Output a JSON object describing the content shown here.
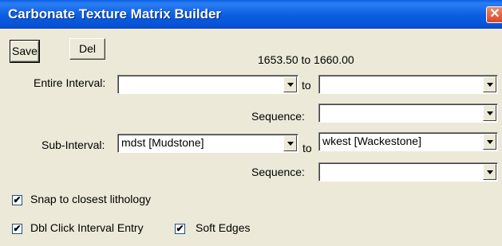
{
  "window": {
    "title": "Carbonate Texture Matrix Builder",
    "close_glyph": "✕"
  },
  "toolbar": {
    "save_label": "Save",
    "delete_label": "Del"
  },
  "depth_range": "1653.50 to 1660.00",
  "entire_interval": {
    "label": "Entire Interval:",
    "from_value": "",
    "to_label": "to",
    "to_value": "",
    "sequence_label": "Sequence:",
    "sequence_value": ""
  },
  "sub_interval": {
    "label": "Sub-Interval:",
    "from_value": "mdst  [Mudstone]",
    "to_label": "to",
    "to_value": "wkest  [Wackestone]",
    "sequence_label": "Sequence:",
    "sequence_value": ""
  },
  "options": {
    "snap": {
      "label": "Snap to closest lithology",
      "checked": true
    },
    "dbl_click": {
      "label": "Dbl Click Interval Entry",
      "checked": true
    },
    "soft_edges": {
      "label": "Soft Edges",
      "checked": true
    }
  },
  "check_glyph": "✔"
}
